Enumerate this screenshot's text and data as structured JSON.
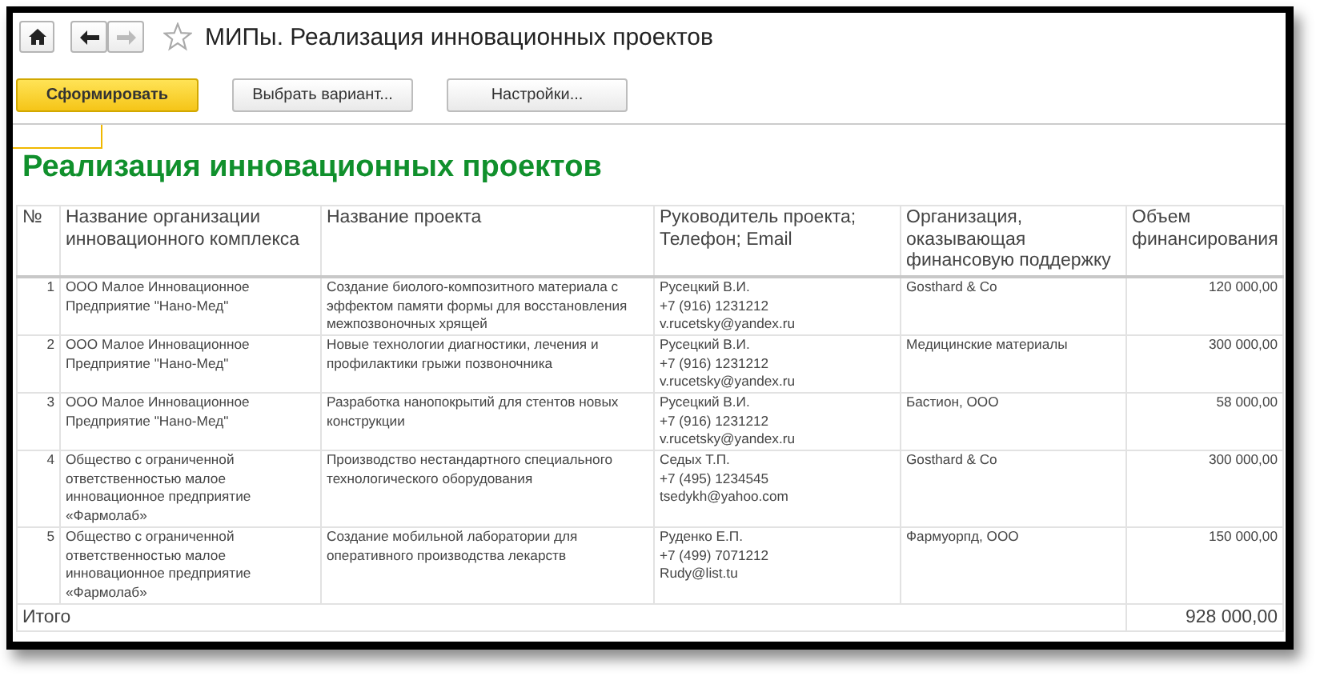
{
  "window": {
    "title": "МИПы. Реализация инновационных проектов"
  },
  "buttons": [
    {
      "label": "Сформировать",
      "kind": "primary"
    },
    {
      "label": "Выбрать вариант...",
      "kind": "normal"
    },
    {
      "label": "Настройки...",
      "kind": "normal"
    }
  ],
  "report": {
    "title": "Реализация инновационных проектов",
    "columns": [
      "№",
      "Название организации инновационного комплекса",
      "Название проекта",
      "Руководитель проекта; Телефон; Email",
      "Организация, оказывающая финансовую поддержку",
      "Объем финансирования"
    ],
    "rows": [
      {
        "number": "1",
        "organization": "ООО Малое Инновационное Предприятие  \"Нано-Мед\"",
        "project": "Создание биолого-композитного материала с эффектом памяти формы для восстановления межпозвоночных хрящей",
        "leader": [
          "Русецкий В.И.",
          "+7 (916) 1231212",
          "v.rucetsky@yandex.ru"
        ],
        "sponsor": "Gosthard & Co",
        "amount": "120 000,00"
      },
      {
        "number": "2",
        "organization": "ООО Малое Инновационное Предприятие  \"Нано-Мед\"",
        "project": "Новые технологии диагностики, лечения и профилактики грыжи позвоночника",
        "leader": [
          "Русецкий В.И.",
          "+7 (916) 1231212",
          "v.rucetsky@yandex.ru"
        ],
        "sponsor": "Медицинские материалы",
        "amount": "300 000,00"
      },
      {
        "number": "3",
        "organization": "ООО Малое Инновационное Предприятие  \"Нано-Мед\"",
        "project": "Разработка нанопокрытий для стентов новых конструкции",
        "leader": [
          "Русецкий В.И.",
          "+7 (916) 1231212",
          "v.rucetsky@yandex.ru"
        ],
        "sponsor": "Бастион, ООО",
        "amount": "58 000,00"
      },
      {
        "number": "4",
        "organization": "Общество с ограниченной ответственностью малое инновационное предприятие «Фармолаб»",
        "project": "Производство нестандартного специального технологического оборудования",
        "leader": [
          "Седых Т.П.",
          "+7 (495) 1234545",
          "tsedykh@yahoo.com"
        ],
        "sponsor": "Gosthard & Co",
        "amount": "300 000,00"
      },
      {
        "number": "5",
        "organization": "Общество с ограниченной ответственностью малое инновационное предприятие «Фармолаб»",
        "project": "Создание мобильной лаборатории для оперативного производства лекарств",
        "leader": [
          "Руденко Е.П.",
          "+7 (499) 7071212",
          "Rudy@list.tu"
        ],
        "sponsor": "Фармуорпд, ООО",
        "amount": "150 000,00"
      }
    ],
    "total": {
      "label": "Итого",
      "amount": "928 000,00"
    }
  }
}
